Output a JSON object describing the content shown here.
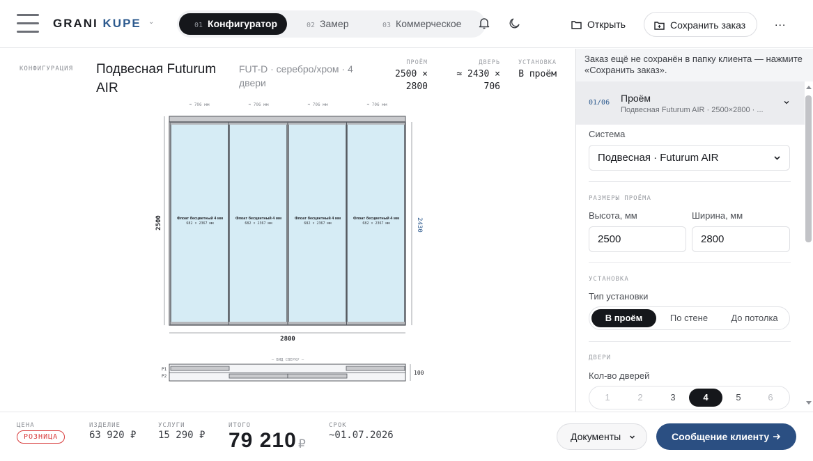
{
  "header": {
    "logo_part1": "GRANI",
    "logo_part2": "KUPE",
    "logo_caret": "⌄",
    "steps": [
      {
        "num": "01",
        "label": "Конфигуратор"
      },
      {
        "num": "02",
        "label": "Замер"
      },
      {
        "num": "03",
        "label": "Коммерческое"
      }
    ],
    "open_label": "Открыть",
    "save_label": "Сохранить заказ",
    "more_label": "..."
  },
  "main": {
    "section_label": "КОНФИГУРАЦИЯ",
    "product_title": "Подвесная Futurum AIR",
    "product_subtitle": "FUT-D · серебро/хром · 4 двери",
    "specs": [
      {
        "key": "ПРОЁМ",
        "line1": "2500 ×",
        "line2": "2800"
      },
      {
        "key": "ДВЕРЬ",
        "line1": "≈ 2430 ×",
        "line2": "706"
      },
      {
        "key": "УСТАНОВКА",
        "line1": "В проём",
        "line2": ""
      }
    ]
  },
  "drawing": {
    "door_width_label": "≈ 706 мм",
    "doors": [
      {
        "glass": "Флоат бесцветный 4 мм",
        "size": "682 × 2367 мм"
      },
      {
        "glass": "Флоат бесцветный 4 мм",
        "size": "682 × 2367 мм"
      },
      {
        "glass": "Флоат бесцветный 4 мм",
        "size": "682 × 2367 мм"
      },
      {
        "glass": "Флоат бесцветный 4 мм",
        "size": "682 × 2367 мм"
      }
    ],
    "height_label": "2500",
    "door_height_label": "2430",
    "width_label": "2800",
    "top_view_label": "— ВИД СВЕРХУ —",
    "rail1_label": "P1",
    "rail2_label": "P2",
    "depth_label": "100",
    "glass_color": "#d6ecf5",
    "frame_color": "#55585e"
  },
  "panel": {
    "notice": "Заказ ещё не сохранён в папку клиента — нажмите «Сохранить заказ».",
    "accordion": {
      "num": "01/06",
      "title": "Проём",
      "subtitle": "Подвесная Futurum AIR · 2500×2800 · ..."
    },
    "system_label": "Система",
    "system_value": "Подвесная · Futurum AIR",
    "dims_section": "РАЗМЕРЫ ПРОЁМА",
    "height_label": "Высота, мм",
    "height_value": "2500",
    "width_label": "Ширина, мм",
    "width_value": "2800",
    "install_section": "УСТАНОВКА",
    "install_type_label": "Тип установки",
    "install_options": [
      "В проём",
      "По стене",
      "До потолка"
    ],
    "install_selected": "В проём",
    "doors_section": "ДВЕРИ",
    "doors_count_label": "Кол-во дверей",
    "door_counts": [
      "1",
      "2",
      "3",
      "4",
      "5",
      "6"
    ],
    "door_count_selected": "4"
  },
  "footer": {
    "price_label": "ЦЕНА",
    "price_badge": "РОЗНИЦА",
    "product_label": "ИЗДЕЛИЕ",
    "product_value": "63 920 ₽",
    "services_label": "УСЛУГИ",
    "services_value": "15 290 ₽",
    "total_label": "ИТОГО",
    "total_value": "79 210",
    "total_currency": "₽",
    "deadline_label": "СРОК",
    "deadline_value": "~01.07.2026",
    "documents_label": "Документы",
    "message_label": "Сообщение клиенту",
    "accent_color": "#2b4f82",
    "badge_color": "#d83a3a"
  }
}
